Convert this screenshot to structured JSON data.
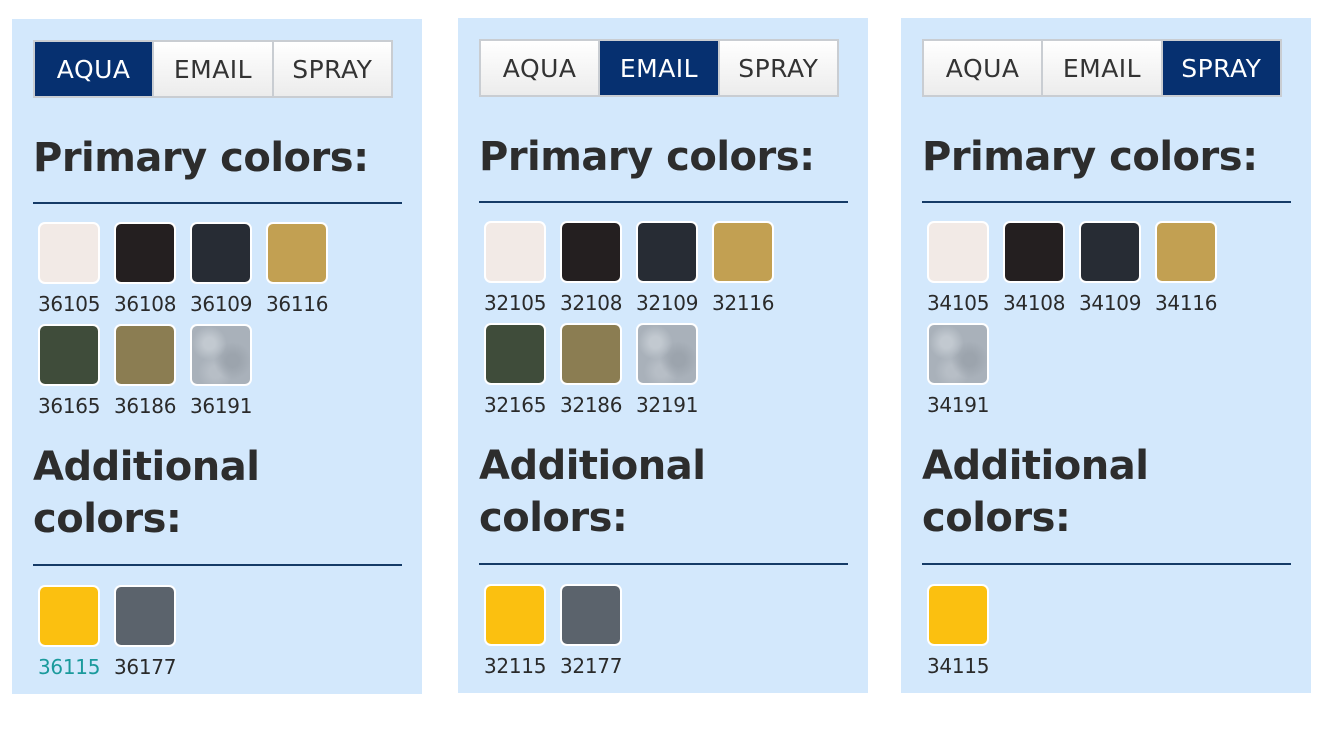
{
  "panels": [
    {
      "tabs": [
        "AQUA",
        "EMAIL",
        "SPRAY"
      ],
      "active_tab": 0,
      "primary_heading": "Primary colors:",
      "additional_heading_line1": "Additional",
      "additional_heading_line2": "colors:",
      "primary": [
        {
          "code": "36105",
          "color": "#f2eae6"
        },
        {
          "code": "36108",
          "color": "#241f20"
        },
        {
          "code": "36109",
          "color": "#272c34"
        },
        {
          "code": "36116",
          "color": "#c2a052"
        },
        {
          "code": "36165",
          "color": "#3f4c3a"
        },
        {
          "code": "36186",
          "color": "#8b7d52"
        },
        {
          "code": "36191",
          "color": "#a9b1ba",
          "pattern": "metallic"
        }
      ],
      "additional": [
        {
          "code": "36115",
          "color": "#fbc010",
          "highlight": true
        },
        {
          "code": "36177",
          "color": "#5b636c"
        }
      ]
    },
    {
      "tabs": [
        "AQUA",
        "EMAIL",
        "SPRAY"
      ],
      "active_tab": 1,
      "primary_heading": "Primary colors:",
      "additional_heading_line1": "Additional",
      "additional_heading_line2": "colors:",
      "primary": [
        {
          "code": "32105",
          "color": "#f2eae6"
        },
        {
          "code": "32108",
          "color": "#241f20"
        },
        {
          "code": "32109",
          "color": "#272c34"
        },
        {
          "code": "32116",
          "color": "#c2a052"
        },
        {
          "code": "32165",
          "color": "#3f4c3a"
        },
        {
          "code": "32186",
          "color": "#8b7d52"
        },
        {
          "code": "32191",
          "color": "#a9b1ba",
          "pattern": "metallic"
        }
      ],
      "additional": [
        {
          "code": "32115",
          "color": "#fbc010"
        },
        {
          "code": "32177",
          "color": "#5b636c"
        }
      ]
    },
    {
      "tabs": [
        "AQUA",
        "EMAIL",
        "SPRAY"
      ],
      "active_tab": 2,
      "primary_heading": "Primary colors:",
      "additional_heading_line1": "Additional",
      "additional_heading_line2": "colors:",
      "primary": [
        {
          "code": "34105",
          "color": "#f2eae6"
        },
        {
          "code": "34108",
          "color": "#241f20"
        },
        {
          "code": "34109",
          "color": "#272c34"
        },
        {
          "code": "34116",
          "color": "#c2a052"
        },
        {
          "code": "34191",
          "color": "#a9b1ba",
          "pattern": "metallic"
        }
      ],
      "additional": [
        {
          "code": "34115",
          "color": "#fbc010"
        }
      ]
    }
  ],
  "theme": {
    "panel_bg": "#d3e8fc",
    "active_tab_bg": "#063070",
    "rule_color": "#153b67",
    "highlight_code_color": "#1a9a9c"
  }
}
